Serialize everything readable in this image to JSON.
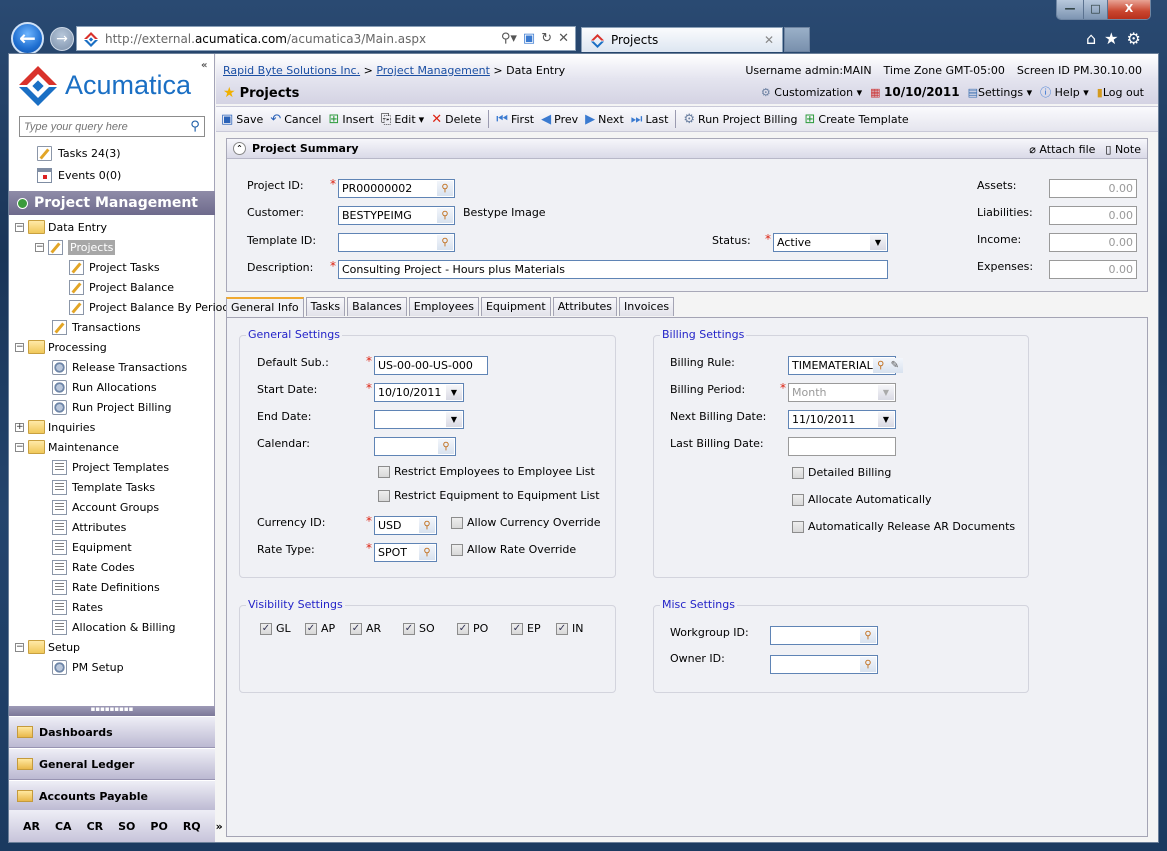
{
  "browser": {
    "url_prefix": "http://external.",
    "url_domain": "acumatica.com",
    "url_path": "/acumatica3/Main.aspx",
    "tab_title": "Projects",
    "window_controls": {
      "minimize": "—",
      "maximize": "□",
      "close": "X"
    }
  },
  "sidebar": {
    "logo_text": "Acumatica",
    "search_placeholder": "Type your query here",
    "tasks": "Tasks 24(3)",
    "events": "Events 0(0)",
    "module_title": "Project Management",
    "tree": [
      {
        "label": "Data Entry",
        "level": 0,
        "type": "folder",
        "toggle": "−"
      },
      {
        "label": "Projects",
        "level": 1,
        "type": "edit",
        "toggle": "−",
        "selected": true
      },
      {
        "label": "Project Tasks",
        "level": 2,
        "type": "edit"
      },
      {
        "label": "Project Balance",
        "level": 2,
        "type": "edit"
      },
      {
        "label": "Project Balance By Period",
        "level": 2,
        "type": "edit"
      },
      {
        "label": "Transactions",
        "level": 1,
        "type": "edit"
      },
      {
        "label": "Processing",
        "level": 0,
        "type": "folder",
        "toggle": "−"
      },
      {
        "label": "Release Transactions",
        "level": 1,
        "type": "gear"
      },
      {
        "label": "Run Allocations",
        "level": 1,
        "type": "gear"
      },
      {
        "label": "Run Project Billing",
        "level": 1,
        "type": "gear"
      },
      {
        "label": "Inquiries",
        "level": 0,
        "type": "folder",
        "toggle": "+"
      },
      {
        "label": "Maintenance",
        "level": 0,
        "type": "folder",
        "toggle": "−"
      },
      {
        "label": "Project Templates",
        "level": 1,
        "type": "list"
      },
      {
        "label": "Template Tasks",
        "level": 1,
        "type": "list"
      },
      {
        "label": "Account Groups",
        "level": 1,
        "type": "list"
      },
      {
        "label": "Attributes",
        "level": 1,
        "type": "list"
      },
      {
        "label": "Equipment",
        "level": 1,
        "type": "list"
      },
      {
        "label": "Rate Codes",
        "level": 1,
        "type": "list"
      },
      {
        "label": "Rate Definitions",
        "level": 1,
        "type": "list"
      },
      {
        "label": "Rates",
        "level": 1,
        "type": "list"
      },
      {
        "label": "Allocation & Billing",
        "level": 1,
        "type": "list"
      },
      {
        "label": "Setup",
        "level": 0,
        "type": "folder",
        "toggle": "−"
      },
      {
        "label": "PM Setup",
        "level": 1,
        "type": "gear"
      }
    ],
    "nav_sections": [
      "Dashboards",
      "General Ledger",
      "Accounts Payable"
    ],
    "modules": [
      "AR",
      "CA",
      "CR",
      "SO",
      "PO",
      "RQ"
    ],
    "more": "»"
  },
  "header": {
    "breadcrumb": [
      "Rapid Byte Solutions Inc.",
      "Project Management",
      "Data Entry"
    ],
    "username": "Username admin:MAIN",
    "timezone": "Time Zone GMT-05:00",
    "screen_id": "Screen ID PM.30.10.00",
    "page_title": "Projects",
    "customization": "Customization",
    "date": "10/10/2011",
    "settings": "Settings",
    "help": "Help",
    "logout": "Log out"
  },
  "toolbar": {
    "save": "Save",
    "cancel": "Cancel",
    "insert": "Insert",
    "edit": "Edit",
    "delete": "Delete",
    "first": "First",
    "prev": "Prev",
    "next": "Next",
    "last": "Last",
    "run_billing": "Run Project Billing",
    "create_template": "Create Template"
  },
  "summary": {
    "title": "Project Summary",
    "attach": "Attach file",
    "note": "Note",
    "project_id_label": "Project ID:",
    "project_id": "PR00000002",
    "customer_label": "Customer:",
    "customer": "BESTYPEIMG",
    "customer_name": "Bestype Image",
    "template_label": "Template ID:",
    "template": "",
    "description_label": "Description:",
    "description": "Consulting Project - Hours plus Materials",
    "status_label": "Status:",
    "status": "Active",
    "assets_label": "Assets:",
    "assets": "0.00",
    "liabilities_label": "Liabilities:",
    "liabilities": "0.00",
    "income_label": "Income:",
    "income": "0.00",
    "expenses_label": "Expenses:",
    "expenses": "0.00"
  },
  "tabs": [
    "General Info",
    "Tasks",
    "Balances",
    "Employees",
    "Equipment",
    "Attributes",
    "Invoices"
  ],
  "general": {
    "title": "General Settings",
    "default_sub_label": "Default Sub.:",
    "default_sub": "US-00-00-US-000",
    "start_date_label": "Start Date:",
    "start_date": "10/10/2011",
    "end_date_label": "End Date:",
    "end_date": "",
    "calendar_label": "Calendar:",
    "calendar": "",
    "restrict_emp": "Restrict Employees to Employee List",
    "restrict_eq": "Restrict Equipment to Equipment List",
    "currency_label": "Currency ID:",
    "currency": "USD",
    "allow_currency": "Allow Currency Override",
    "rate_type_label": "Rate Type:",
    "rate_type": "SPOT",
    "allow_rate": "Allow Rate Override"
  },
  "billing": {
    "title": "Billing Settings",
    "rule_label": "Billing Rule:",
    "rule": "TIMEMATERIAL",
    "period_label": "Billing Period:",
    "period": "Month",
    "next_label": "Next Billing Date:",
    "next": "11/10/2011",
    "last_label": "Last Billing Date:",
    "last": "",
    "detailed": "Detailed Billing",
    "allocate": "Allocate Automatically",
    "release": "Automatically Release AR Documents"
  },
  "visibility": {
    "title": "Visibility Settings",
    "items": [
      "GL",
      "AP",
      "AR",
      "SO",
      "PO",
      "EP",
      "IN"
    ]
  },
  "misc": {
    "title": "Misc Settings",
    "workgroup_label": "Workgroup ID:",
    "workgroup": "",
    "owner_label": "Owner ID:",
    "owner": ""
  }
}
